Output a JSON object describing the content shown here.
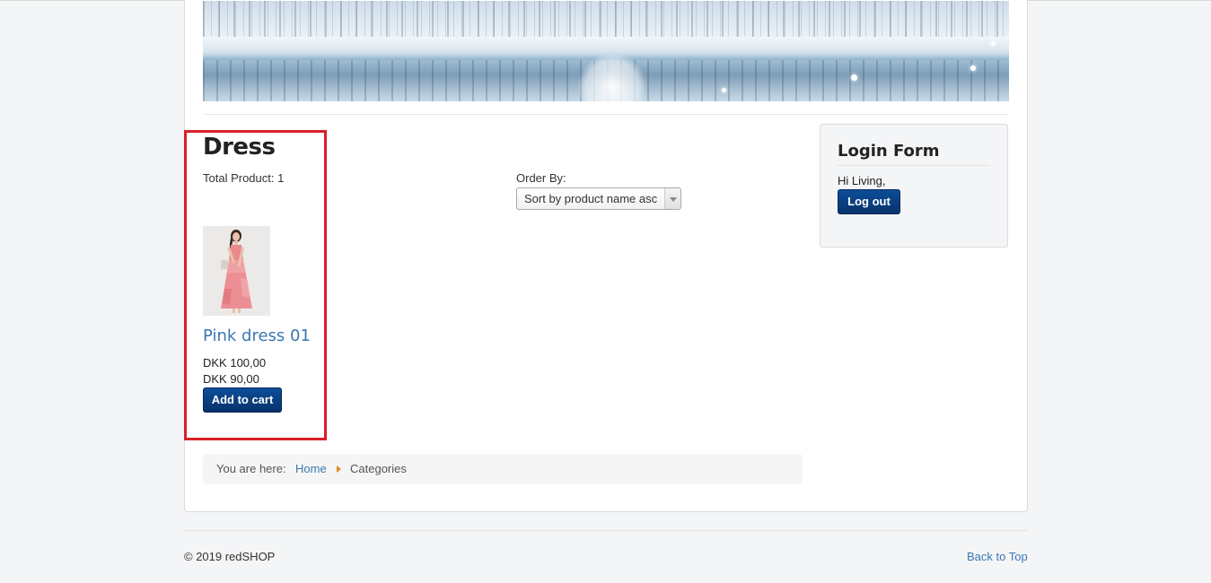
{
  "category": {
    "title": "Dress",
    "total_label": "Total Product: 1"
  },
  "order_by": {
    "label": "Order By:",
    "selected": "Sort by product name asc"
  },
  "product": {
    "name": "Pink dress 01",
    "price_old": "DKK 100,00",
    "price_new": "DKK 90,00",
    "add_to_cart_label": "Add to cart",
    "image_alt": "Pink dress 01"
  },
  "login_form": {
    "title": "Login Form",
    "greeting": "Hi Living,",
    "logout_label": "Log out"
  },
  "breadcrumb": {
    "prefix": "You are here:",
    "home": "Home",
    "current": "Categories"
  },
  "footer": {
    "copyright": "© 2019 redSHOP",
    "back_to_top": "Back to Top"
  },
  "colors": {
    "link": "#3b77b2",
    "button": "#0a4286",
    "highlight_border": "#d9202a",
    "breadcrumb_separator": "#e08a1e"
  }
}
